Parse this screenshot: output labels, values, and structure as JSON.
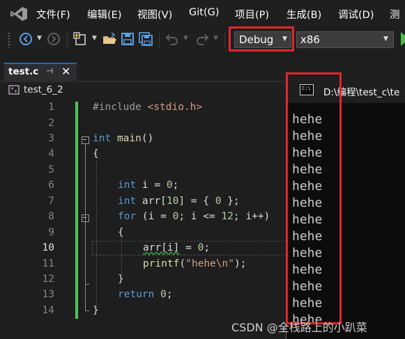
{
  "menu": {
    "items": [
      "文件(F)",
      "编辑(E)",
      "视图(V)",
      "Git(G)",
      "项目(P)",
      "生成(B)",
      "调试(D)",
      "测"
    ]
  },
  "toolbar": {
    "icons": [
      "back-icon",
      "forward-icon",
      "new-item-icon",
      "open-folder-icon",
      "save-icon",
      "save-all-icon",
      "undo-icon",
      "redo-icon"
    ],
    "configuration": "Debug",
    "platform": "x86",
    "run_color": "#3fc13f"
  },
  "editor": {
    "tab": {
      "label": "test.c",
      "pin": "⊣",
      "close": "✕"
    },
    "project": "test_6_2",
    "current_line": 10,
    "line_numbers": [
      "1",
      "2",
      "3",
      "4",
      "5",
      "6",
      "7",
      "8",
      "9",
      "10",
      "11",
      "12",
      "13",
      "14"
    ],
    "code": {
      "l1": {
        "pp": "#include ",
        "str": "<stdio.h>"
      },
      "l3": {
        "kw": "int",
        "fn": "main",
        "rest": "()"
      },
      "l4": "{",
      "l6": {
        "kw": "int",
        "rest_a": " i = ",
        "num": "0",
        "rest_b": ";"
      },
      "l7": {
        "kw": "int",
        "rest_a": " arr[",
        "num_a": "10",
        "rest_b": "] = { ",
        "num_b": "0",
        "rest_c": " };"
      },
      "l8": {
        "kw": "for",
        "rest_a": " (i = ",
        "num_a": "0",
        "rest_b": "; i <= ",
        "num_b": "12",
        "rest_c": "; i++)"
      },
      "l9": "{",
      "l10": {
        "squiggle": "arr[i]",
        "rest_a": " = ",
        "num": "0",
        "rest_b": ";"
      },
      "l11": {
        "fn": "printf",
        "rest_a": "(",
        "str": "\"hehe\\n\"",
        "rest_b": ");"
      },
      "l12": "}",
      "l13": {
        "kw": "return",
        "rest_a": " ",
        "num": "0",
        "rest_b": ";"
      },
      "l14": "}"
    }
  },
  "console": {
    "title": "D:\\编程\\test_c\\te",
    "icon_glyph": "C:\\",
    "lines": [
      "hehe",
      "hehe",
      "hehe",
      "hehe",
      "hehe",
      "hehe",
      "hehe",
      "hehe",
      "hehe",
      "hehe",
      "hehe",
      "hehe",
      "hehe"
    ]
  },
  "watermark": "CSDN @全栈路上的小趴菜",
  "colors": {
    "highlight": "#e3262b",
    "keyword": "#569cd6",
    "change_bar": "#4ec160"
  }
}
